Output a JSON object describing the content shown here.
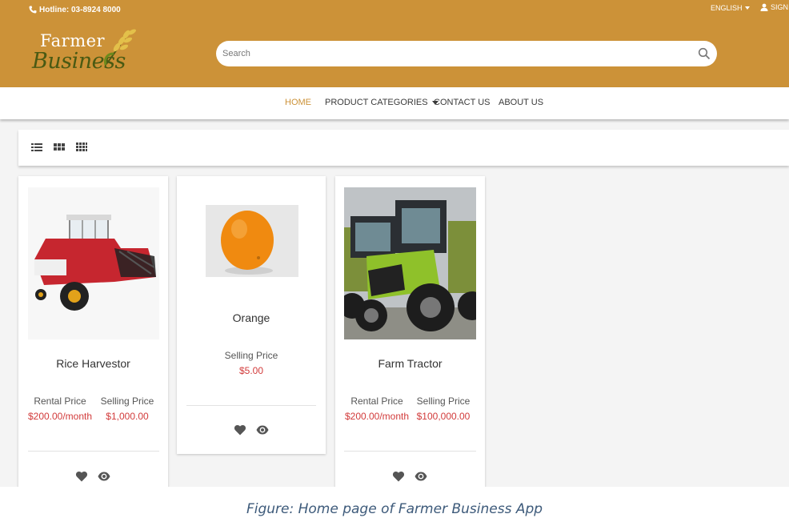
{
  "header": {
    "hotline": "Hotline: 03-8924 8000",
    "language": "ENGLISH",
    "sign": "SIGN",
    "logo_top": "Farmer",
    "logo_bottom": "Business",
    "search_placeholder": "Search"
  },
  "nav": {
    "home": "HOME",
    "product_categories": "PRODUCT CATEGORIES",
    "contact_us": "CONTACT US",
    "about_us": "ABOUT US"
  },
  "products": [
    {
      "name": "Rice Harvestor",
      "rental_label": "Rental Price",
      "rental_price": "$200.00/month",
      "selling_label": "Selling Price",
      "selling_price": "$1,000.00"
    },
    {
      "name": "Orange",
      "selling_label": "Selling Price",
      "selling_price": "$5.00"
    },
    {
      "name": "Farm Tractor",
      "rental_label": "Rental Price",
      "rental_price": "$200.00/month",
      "selling_label": "Selling Price",
      "selling_price": "$100,000.00"
    }
  ],
  "caption": "Figure: Home page of Farmer Business App",
  "colors": {
    "header": "#cc9238",
    "active_nav": "#cc9238",
    "price": "#d23b3b",
    "logo_green": "#4a5a13"
  }
}
